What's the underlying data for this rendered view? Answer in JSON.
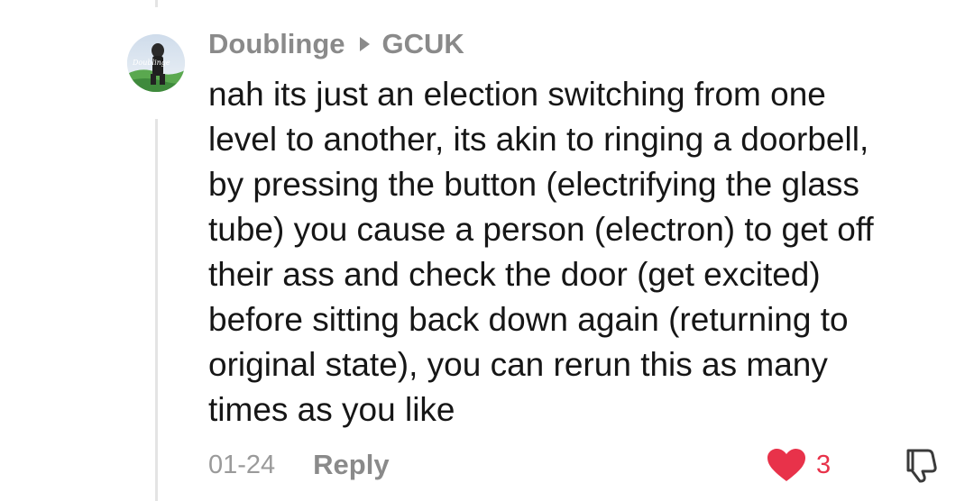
{
  "comment": {
    "username": "Doublinge",
    "reply_target": "GCUK",
    "avatar_text": "Doublinge",
    "lines": [
      "nah its just an election switching from one",
      "level to another, its akin to ringing a doorbell,",
      "by pressing the button (electrifying the glass",
      "tube) you cause a person (electron) to get off",
      "their ass and check the door (get excited)",
      "before sitting back down again (returning to",
      "original state), you can rerun this as many",
      "times as you like"
    ],
    "date": "01-24",
    "reply_label": "Reply",
    "like_count": "3"
  },
  "colors": {
    "like": "#e8324a",
    "muted": "#8a8a8a",
    "text": "#161616"
  },
  "icons": {
    "arrow": "play-arrow-icon",
    "like": "heart-icon",
    "dislike": "thumbs-down-icon"
  }
}
